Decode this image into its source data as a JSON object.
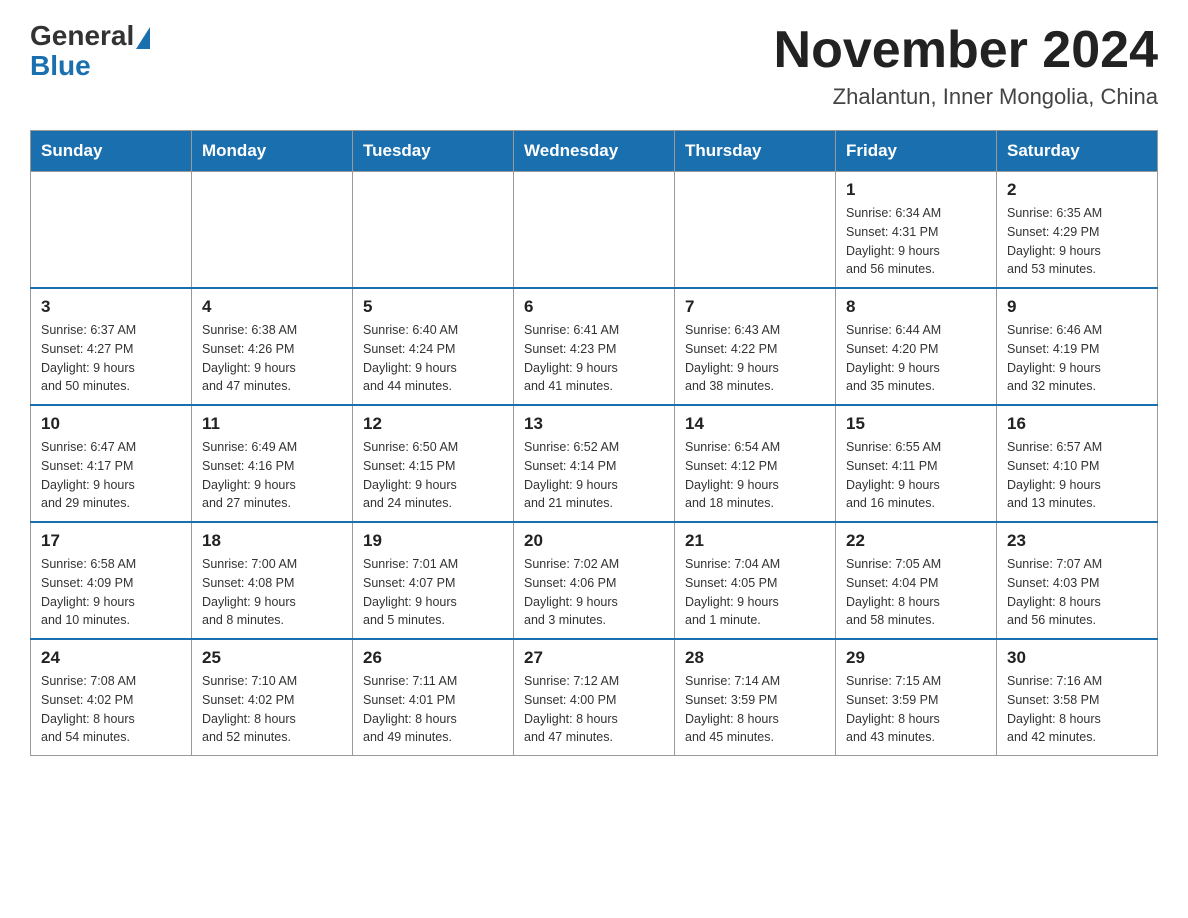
{
  "logo": {
    "general": "General",
    "blue": "Blue"
  },
  "title": "November 2024",
  "location": "Zhalantun, Inner Mongolia, China",
  "weekdays": [
    "Sunday",
    "Monday",
    "Tuesday",
    "Wednesday",
    "Thursday",
    "Friday",
    "Saturday"
  ],
  "weeks": [
    [
      {
        "day": "",
        "info": ""
      },
      {
        "day": "",
        "info": ""
      },
      {
        "day": "",
        "info": ""
      },
      {
        "day": "",
        "info": ""
      },
      {
        "day": "",
        "info": ""
      },
      {
        "day": "1",
        "info": "Sunrise: 6:34 AM\nSunset: 4:31 PM\nDaylight: 9 hours\nand 56 minutes."
      },
      {
        "day": "2",
        "info": "Sunrise: 6:35 AM\nSunset: 4:29 PM\nDaylight: 9 hours\nand 53 minutes."
      }
    ],
    [
      {
        "day": "3",
        "info": "Sunrise: 6:37 AM\nSunset: 4:27 PM\nDaylight: 9 hours\nand 50 minutes."
      },
      {
        "day": "4",
        "info": "Sunrise: 6:38 AM\nSunset: 4:26 PM\nDaylight: 9 hours\nand 47 minutes."
      },
      {
        "day": "5",
        "info": "Sunrise: 6:40 AM\nSunset: 4:24 PM\nDaylight: 9 hours\nand 44 minutes."
      },
      {
        "day": "6",
        "info": "Sunrise: 6:41 AM\nSunset: 4:23 PM\nDaylight: 9 hours\nand 41 minutes."
      },
      {
        "day": "7",
        "info": "Sunrise: 6:43 AM\nSunset: 4:22 PM\nDaylight: 9 hours\nand 38 minutes."
      },
      {
        "day": "8",
        "info": "Sunrise: 6:44 AM\nSunset: 4:20 PM\nDaylight: 9 hours\nand 35 minutes."
      },
      {
        "day": "9",
        "info": "Sunrise: 6:46 AM\nSunset: 4:19 PM\nDaylight: 9 hours\nand 32 minutes."
      }
    ],
    [
      {
        "day": "10",
        "info": "Sunrise: 6:47 AM\nSunset: 4:17 PM\nDaylight: 9 hours\nand 29 minutes."
      },
      {
        "day": "11",
        "info": "Sunrise: 6:49 AM\nSunset: 4:16 PM\nDaylight: 9 hours\nand 27 minutes."
      },
      {
        "day": "12",
        "info": "Sunrise: 6:50 AM\nSunset: 4:15 PM\nDaylight: 9 hours\nand 24 minutes."
      },
      {
        "day": "13",
        "info": "Sunrise: 6:52 AM\nSunset: 4:14 PM\nDaylight: 9 hours\nand 21 minutes."
      },
      {
        "day": "14",
        "info": "Sunrise: 6:54 AM\nSunset: 4:12 PM\nDaylight: 9 hours\nand 18 minutes."
      },
      {
        "day": "15",
        "info": "Sunrise: 6:55 AM\nSunset: 4:11 PM\nDaylight: 9 hours\nand 16 minutes."
      },
      {
        "day": "16",
        "info": "Sunrise: 6:57 AM\nSunset: 4:10 PM\nDaylight: 9 hours\nand 13 minutes."
      }
    ],
    [
      {
        "day": "17",
        "info": "Sunrise: 6:58 AM\nSunset: 4:09 PM\nDaylight: 9 hours\nand 10 minutes."
      },
      {
        "day": "18",
        "info": "Sunrise: 7:00 AM\nSunset: 4:08 PM\nDaylight: 9 hours\nand 8 minutes."
      },
      {
        "day": "19",
        "info": "Sunrise: 7:01 AM\nSunset: 4:07 PM\nDaylight: 9 hours\nand 5 minutes."
      },
      {
        "day": "20",
        "info": "Sunrise: 7:02 AM\nSunset: 4:06 PM\nDaylight: 9 hours\nand 3 minutes."
      },
      {
        "day": "21",
        "info": "Sunrise: 7:04 AM\nSunset: 4:05 PM\nDaylight: 9 hours\nand 1 minute."
      },
      {
        "day": "22",
        "info": "Sunrise: 7:05 AM\nSunset: 4:04 PM\nDaylight: 8 hours\nand 58 minutes."
      },
      {
        "day": "23",
        "info": "Sunrise: 7:07 AM\nSunset: 4:03 PM\nDaylight: 8 hours\nand 56 minutes."
      }
    ],
    [
      {
        "day": "24",
        "info": "Sunrise: 7:08 AM\nSunset: 4:02 PM\nDaylight: 8 hours\nand 54 minutes."
      },
      {
        "day": "25",
        "info": "Sunrise: 7:10 AM\nSunset: 4:02 PM\nDaylight: 8 hours\nand 52 minutes."
      },
      {
        "day": "26",
        "info": "Sunrise: 7:11 AM\nSunset: 4:01 PM\nDaylight: 8 hours\nand 49 minutes."
      },
      {
        "day": "27",
        "info": "Sunrise: 7:12 AM\nSunset: 4:00 PM\nDaylight: 8 hours\nand 47 minutes."
      },
      {
        "day": "28",
        "info": "Sunrise: 7:14 AM\nSunset: 3:59 PM\nDaylight: 8 hours\nand 45 minutes."
      },
      {
        "day": "29",
        "info": "Sunrise: 7:15 AM\nSunset: 3:59 PM\nDaylight: 8 hours\nand 43 minutes."
      },
      {
        "day": "30",
        "info": "Sunrise: 7:16 AM\nSunset: 3:58 PM\nDaylight: 8 hours\nand 42 minutes."
      }
    ]
  ]
}
